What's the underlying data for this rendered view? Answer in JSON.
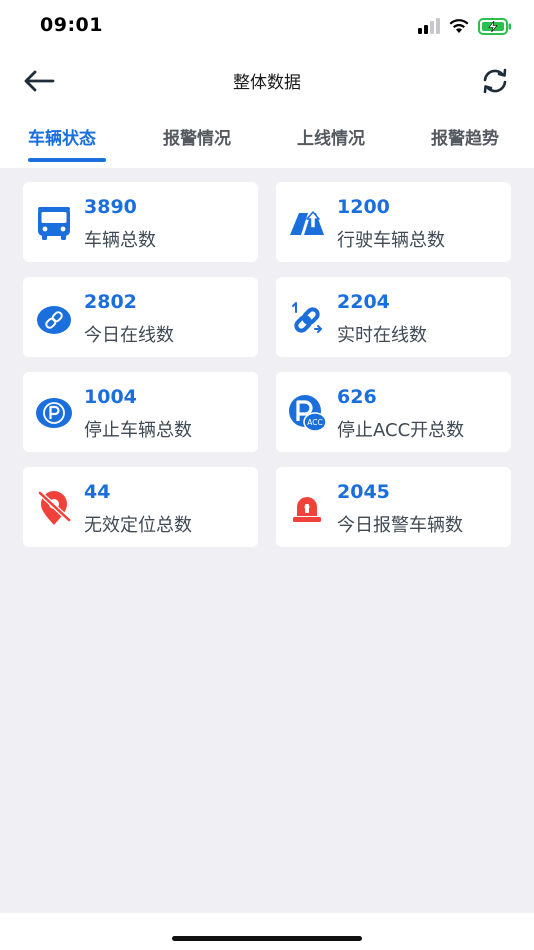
{
  "status": {
    "time": "09:01"
  },
  "header": {
    "title": "整体数据"
  },
  "tabs": [
    {
      "label": "车辆状态",
      "active": true
    },
    {
      "label": "报警情况",
      "active": false
    },
    {
      "label": "上线情况",
      "active": false
    },
    {
      "label": "报警趋势",
      "active": false
    }
  ],
  "cards": [
    {
      "value": "3890",
      "label": "车辆总数",
      "icon": "bus-icon"
    },
    {
      "value": "1200",
      "label": "行驶车辆总数",
      "icon": "road-driving-icon"
    },
    {
      "value": "2802",
      "label": "今日在线数",
      "icon": "link-icon"
    },
    {
      "value": "2204",
      "label": "实时在线数",
      "icon": "realtime-link-icon"
    },
    {
      "value": "1004",
      "label": "停止车辆总数",
      "icon": "parking-icon"
    },
    {
      "value": "626",
      "label": "停止ACC开总数",
      "icon": "parking-acc-icon",
      "badge": "ACC"
    },
    {
      "value": "44",
      "label": "无效定位总数",
      "icon": "location-off-icon"
    },
    {
      "value": "2045",
      "label": "今日报警车辆数",
      "icon": "alarm-light-icon"
    }
  ],
  "colors": {
    "accent": "#1a6fdc",
    "alert": "#f0423a",
    "background": "#f0f0f4"
  }
}
